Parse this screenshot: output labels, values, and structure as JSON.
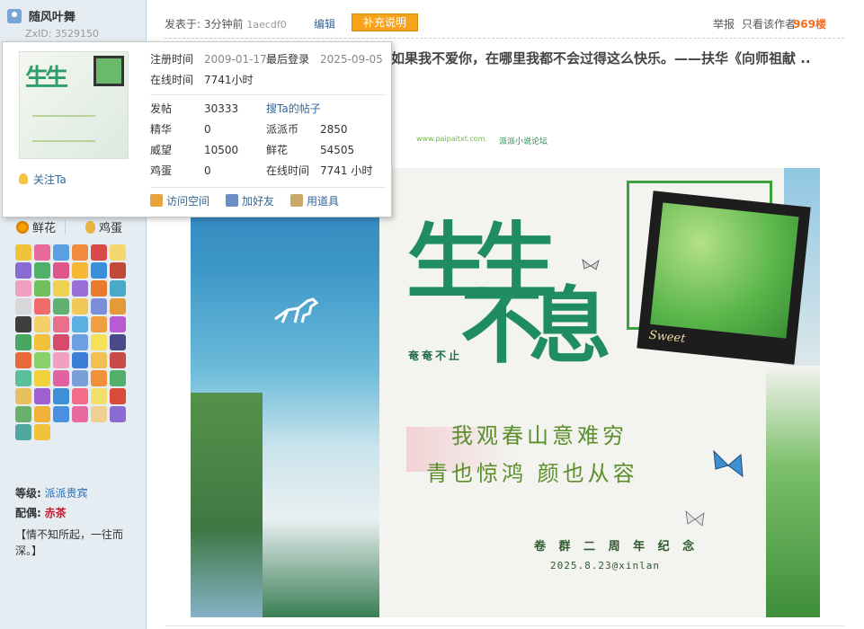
{
  "user": {
    "name": "随风叶舞",
    "zxid": "ZxID:  3529150"
  },
  "popup": {
    "reg_label": "注册时间",
    "reg_value": "2009-01-17",
    "last_label": "最后登录",
    "last_value": "2025-09-05",
    "online_label": "在线时间",
    "online_value": "7741小时",
    "stats": [
      {
        "label": "发帖",
        "value": "30333"
      },
      {
        "label": "精华",
        "value": "0"
      },
      {
        "label": "威望",
        "value": "10500"
      },
      {
        "label": "鸡蛋",
        "value": "0"
      }
    ],
    "stats2": [
      {
        "label": "搜Ta的帖子",
        "value": ""
      },
      {
        "label": "派派币",
        "value": "2850"
      },
      {
        "label": "鲜花",
        "value": "54505"
      },
      {
        "label": "在线时间",
        "value": "7741 小时"
      }
    ],
    "follow": "关注Ta",
    "actions": [
      {
        "label": "访问空间",
        "icon": "home-icon",
        "color": "#e8a33d"
      },
      {
        "label": "加好友",
        "icon": "add-friend-icon",
        "color": "#6b8fc4"
      },
      {
        "label": "用道具",
        "icon": "wand-icon",
        "color": "#c9a86a"
      }
    ]
  },
  "sidebar": {
    "flower_label": "鲜花",
    "egg_label": "鸡蛋",
    "level_label": "等级:",
    "level_value": "派派贵宾",
    "spouse_label": "配偶:",
    "spouse_value": "赤茶",
    "signature": "【情不知所起，一往而深。】",
    "medal_colors": [
      "#f2c23a",
      "#e86a9c",
      "#5aa0e0",
      "#f08a3c",
      "#d94a4a",
      "#f5d76e",
      "#8a6bd1",
      "#4fb06a",
      "#e0568a",
      "#f7b733",
      "#3b8ed8",
      "#c2483a",
      "#f2a0c0",
      "#6fc05a",
      "#f0d050",
      "#9a6fd8",
      "#e77a2e",
      "#4aa8c8",
      "#d8d8d8",
      "#f26b6b",
      "#60b070",
      "#f3c85a",
      "#7a8fd8",
      "#e59a3a",
      "#3e3e3e",
      "#f4d06a",
      "#e8708a",
      "#5ab0e0",
      "#f0a040",
      "#b85ad0",
      "#48a860",
      "#f2c23a",
      "#d84a6a",
      "#6aa0e0",
      "#f6e05a",
      "#4a4a8a",
      "#e86a3a",
      "#8ad06a",
      "#f2a0c0",
      "#3b7ed8",
      "#f0c050",
      "#c84a4a",
      "#5ac09a",
      "#f2d23a",
      "#e060a0",
      "#7a9fd8",
      "#f0903a",
      "#50b06a",
      "#e8c060",
      "#a060d0",
      "#3e8ed8",
      "#f26b8b",
      "#f3e06a",
      "#d84a3a",
      "#6ab06a",
      "#f2b23a",
      "#4a90e0",
      "#e86aa0",
      "#f0d090",
      "#8a6bd1",
      "#50a8a0",
      "#f2c23a"
    ]
  },
  "post": {
    "posted_prefix": "发表于: 3分钟前",
    "hash": "1aecdf0",
    "edit": "编辑",
    "supplement": "补充说明",
    "report": "举报",
    "only_author": "只看该作者",
    "floor": "969楼",
    "quote": "如果我不爱你，在哪里我都不会过得这么快乐。——扶华《向师祖献 ..",
    "stray_url": "www.paipaitxt.com",
    "stray_forum": "派派小说论坛"
  },
  "poster": {
    "calli_a": "生生",
    "calli_b": "不息",
    "seal": "奄奄不止",
    "line1": "我观春山意难穷",
    "line2": "青也惊鸿  颜也从容",
    "anniv": "卷 群 二 周 年 纪 念",
    "date": "2025.8.23@xinlan",
    "sweet": "Sweet"
  }
}
